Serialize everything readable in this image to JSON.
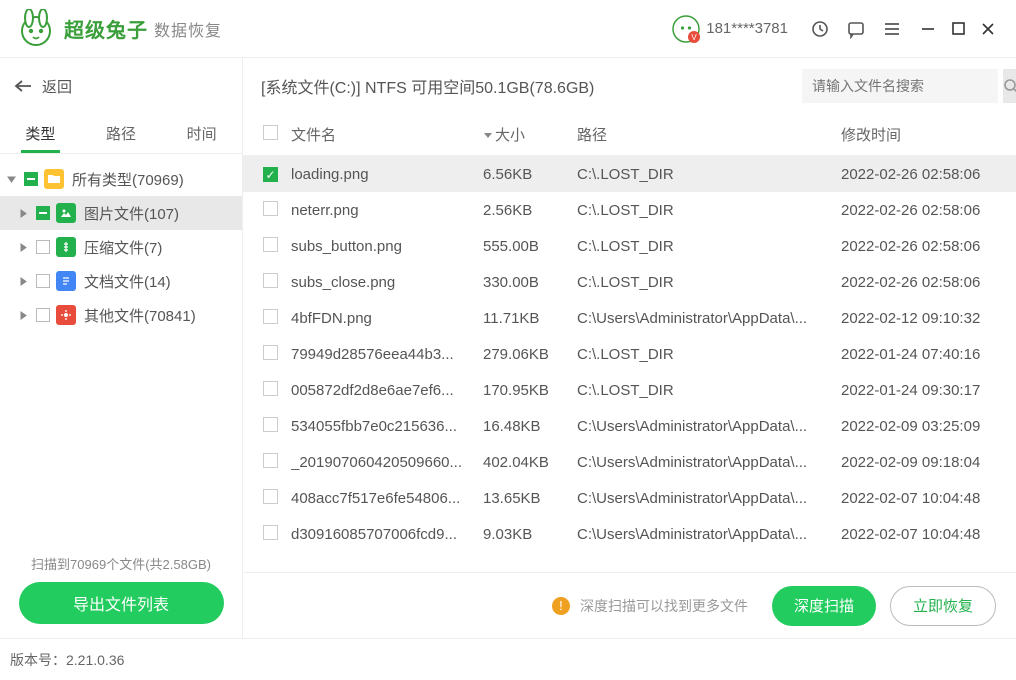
{
  "brand": "超级兔子",
  "brand_sub": "数据恢复",
  "user_phone": "181****3781",
  "back_label": "返回",
  "tabs": {
    "type": "类型",
    "path": "路径",
    "time": "时间"
  },
  "tree": [
    {
      "label": "所有类型(70969)",
      "icon": "folder",
      "partial": true,
      "indent": 0,
      "caret": "down"
    },
    {
      "label": "图片文件(107)",
      "icon": "image",
      "partial": true,
      "indent": 1,
      "caret": "right",
      "selected": true
    },
    {
      "label": "压缩文件(7)",
      "icon": "archive",
      "partial": false,
      "indent": 1,
      "caret": "right"
    },
    {
      "label": "文档文件(14)",
      "icon": "doc",
      "partial": false,
      "indent": 1,
      "caret": "right"
    },
    {
      "label": "其他文件(70841)",
      "icon": "other",
      "partial": false,
      "indent": 1,
      "caret": "right"
    }
  ],
  "scan_info": "扫描到70969个文件(共2.58GB)",
  "export_btn": "导出文件列表",
  "path_row": "[系统文件(C:)] NTFS 可用空间50.1GB(78.6GB)",
  "search_placeholder": "请输入文件名搜索",
  "columns": {
    "name": "文件名",
    "size": "大小",
    "path": "路径",
    "time": "修改时间"
  },
  "files": [
    {
      "chk": true,
      "name": "loading.png",
      "size": "6.56KB",
      "path": "C:\\.LOST_DIR",
      "time": "2022-02-26 02:58:06",
      "selected": true
    },
    {
      "chk": false,
      "name": "neterr.png",
      "size": "2.56KB",
      "path": "C:\\.LOST_DIR",
      "time": "2022-02-26 02:58:06"
    },
    {
      "chk": false,
      "name": "subs_button.png",
      "size": "555.00B",
      "path": "C:\\.LOST_DIR",
      "time": "2022-02-26 02:58:06"
    },
    {
      "chk": false,
      "name": "subs_close.png",
      "size": "330.00B",
      "path": "C:\\.LOST_DIR",
      "time": "2022-02-26 02:58:06"
    },
    {
      "chk": false,
      "name": "4bfFDN.png",
      "size": "11.71KB",
      "path": "C:\\Users\\Administrator\\AppData\\...",
      "time": "2022-02-12 09:10:32"
    },
    {
      "chk": false,
      "name": "79949d28576eea44b3...",
      "size": "279.06KB",
      "path": "C:\\.LOST_DIR",
      "time": "2022-01-24 07:40:16"
    },
    {
      "chk": false,
      "name": "005872df2d8e6ae7ef6...",
      "size": "170.95KB",
      "path": "C:\\.LOST_DIR",
      "time": "2022-01-24 09:30:17"
    },
    {
      "chk": false,
      "name": "534055fbb7e0c215636...",
      "size": "16.48KB",
      "path": "C:\\Users\\Administrator\\AppData\\...",
      "time": "2022-02-09 03:25:09"
    },
    {
      "chk": false,
      "name": "_201907060420509660...",
      "size": "402.04KB",
      "path": "C:\\Users\\Administrator\\AppData\\...",
      "time": "2022-02-09 09:18:04"
    },
    {
      "chk": false,
      "name": "408acc7f517e6fe54806...",
      "size": "13.65KB",
      "path": "C:\\Users\\Administrator\\AppData\\...",
      "time": "2022-02-07 10:04:48"
    },
    {
      "chk": false,
      "name": "d30916085707006fcd9...",
      "size": "9.03KB",
      "path": "C:\\Users\\Administrator\\AppData\\...",
      "time": "2022-02-07 10:04:48"
    }
  ],
  "warn_text": "深度扫描可以找到更多文件",
  "deep_btn": "深度扫描",
  "recover_btn": "立即恢复",
  "version_label": "版本号：",
  "version": "2.21.0.36"
}
